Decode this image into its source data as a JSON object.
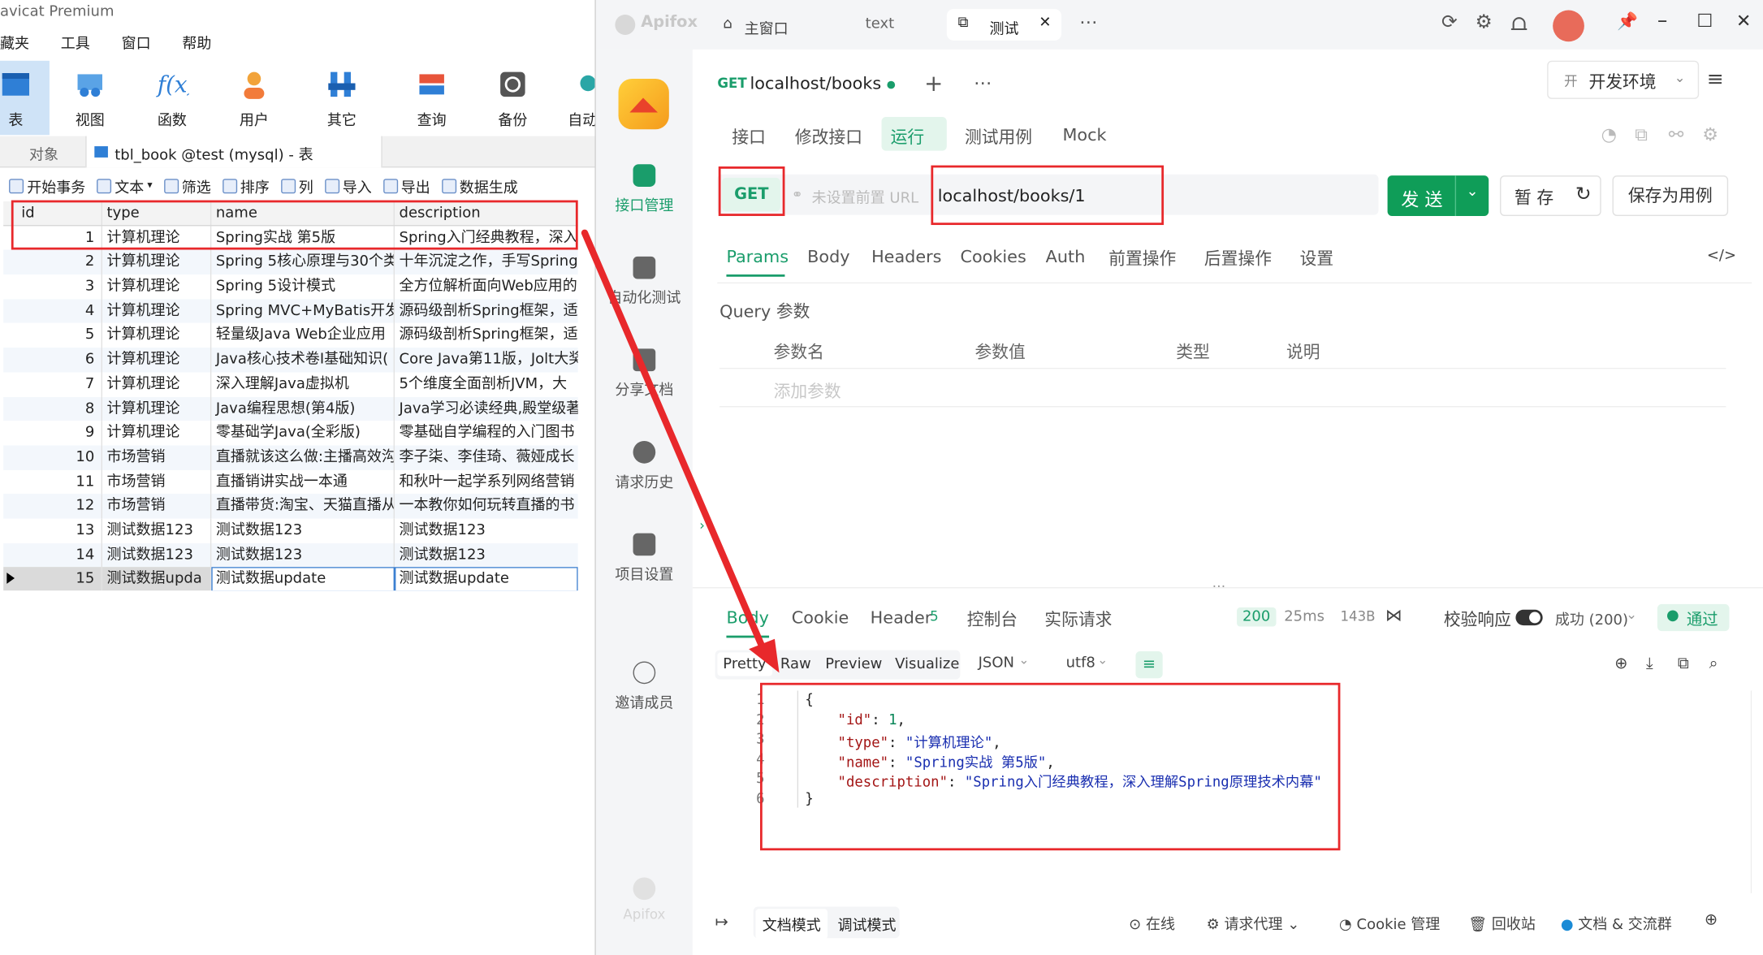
{
  "navicat": {
    "title": "avicat Premium",
    "menu": [
      "藏夹",
      "工具",
      "窗口",
      "帮助"
    ],
    "toolbar": [
      "表",
      "视图",
      "函数",
      "用户",
      "其它",
      "查询",
      "备份",
      "自动"
    ],
    "tabs": {
      "objects": "对象",
      "active": "tbl_book @test (mysql) - 表"
    },
    "toolbar2": [
      "开始事务",
      "文本",
      "筛选",
      "排序",
      "列",
      "导入",
      "导出",
      "数据生成"
    ],
    "columns": [
      "id",
      "type",
      "name",
      "description"
    ],
    "rows": [
      [
        "1",
        "计算机理论",
        "Spring实战 第5版",
        "Spring入门经典教程，深入"
      ],
      [
        "2",
        "计算机理论",
        "Spring 5核心原理与30个类",
        "十年沉淀之作，手写Spring"
      ],
      [
        "3",
        "计算机理论",
        "Spring 5设计模式",
        "全方位解析面向Web应用的"
      ],
      [
        "4",
        "计算机理论",
        "Spring MVC+MyBatis开发",
        "源码级剖析Spring框架，适"
      ],
      [
        "5",
        "计算机理论",
        "轻量级Java Web企业应用",
        "源码级剖析Spring框架，适"
      ],
      [
        "6",
        "计算机理论",
        "Java核心技术卷I基础知识(",
        "Core Java第11版，Jolt大奖"
      ],
      [
        "7",
        "计算机理论",
        "深入理解Java虚拟机",
        "5个维度全面剖析JVM，大"
      ],
      [
        "8",
        "计算机理论",
        "Java编程思想(第4版)",
        "Java学习必读经典,殿堂级著"
      ],
      [
        "9",
        "计算机理论",
        "零基础学Java(全彩版)",
        "零基础自学编程的入门图书"
      ],
      [
        "10",
        "市场营销",
        "直播就该这么做:主播高效沟",
        "李子柒、李佳琦、薇娅成长"
      ],
      [
        "11",
        "市场营销",
        "直播销讲实战一本通",
        "和秋叶一起学系列网络营销"
      ],
      [
        "12",
        "市场营销",
        "直播带货:淘宝、天猫直播从",
        "一本教你如何玩转直播的书"
      ],
      [
        "13",
        "测试数据123",
        "测试数据123",
        "测试数据123"
      ],
      [
        "14",
        "测试数据123",
        "测试数据123",
        "测试数据123"
      ],
      [
        "15",
        "测试数据upda",
        "测试数据update",
        "测试数据update"
      ]
    ]
  },
  "apifox": {
    "brand": "Apifox",
    "top_tabs": [
      "主窗口",
      "text",
      "测试"
    ],
    "sidebar": [
      "接口管理",
      "自动化测试",
      "分享文档",
      "请求历史",
      "项目设置",
      "邀请成员"
    ],
    "sidebar_footer": "Apifox",
    "req_tab": {
      "method": "GET",
      "label": "localhost/books"
    },
    "env": {
      "badge": "开",
      "label": "开发环境"
    },
    "sub_tabs": [
      "接口",
      "修改接口",
      "运行",
      "测试用例",
      "Mock"
    ],
    "method": "GET",
    "prefix_placeholder": "未设置前置 URL",
    "url": "localhost/books/1",
    "buttons": {
      "send": "发 送",
      "save": "暂 存",
      "save_case": "保存为用例"
    },
    "param_tabs": [
      "Params",
      "Body",
      "Headers",
      "Cookies",
      "Auth",
      "前置操作",
      "后置操作",
      "设置"
    ],
    "query_title": "Query 参数",
    "param_cols": [
      "参数名",
      "参数值",
      "类型",
      "说明"
    ],
    "add_param": "添加参数",
    "resp_tabs": [
      "Body",
      "Cookie",
      "Header",
      "控制台",
      "实际请求"
    ],
    "header_count": "5",
    "status": {
      "code": "200",
      "time": "25ms",
      "size": "143B",
      "validate": "校验响应",
      "result": "成功 (200)",
      "pass": "通过"
    },
    "view_modes": [
      "Pretty",
      "Raw",
      "Preview",
      "Visualize"
    ],
    "format": "JSON",
    "encoding": "utf8",
    "code_lines": [
      "{",
      "\"id\": 1,",
      "\"type\": \"计算机理论\",",
      "\"name\": \"Spring实战 第5版\",",
      "\"description\": \"Spring入门经典教程，深入理解Spring原理技术内幕\"",
      "}"
    ],
    "footer": [
      "文档模式",
      "调试模式",
      "在线",
      "请求代理",
      "Cookie 管理",
      "回收站",
      "文档 & 交流群"
    ]
  },
  "colors": {
    "accent": "#0f9d58",
    "annotation": "#e8282b"
  }
}
